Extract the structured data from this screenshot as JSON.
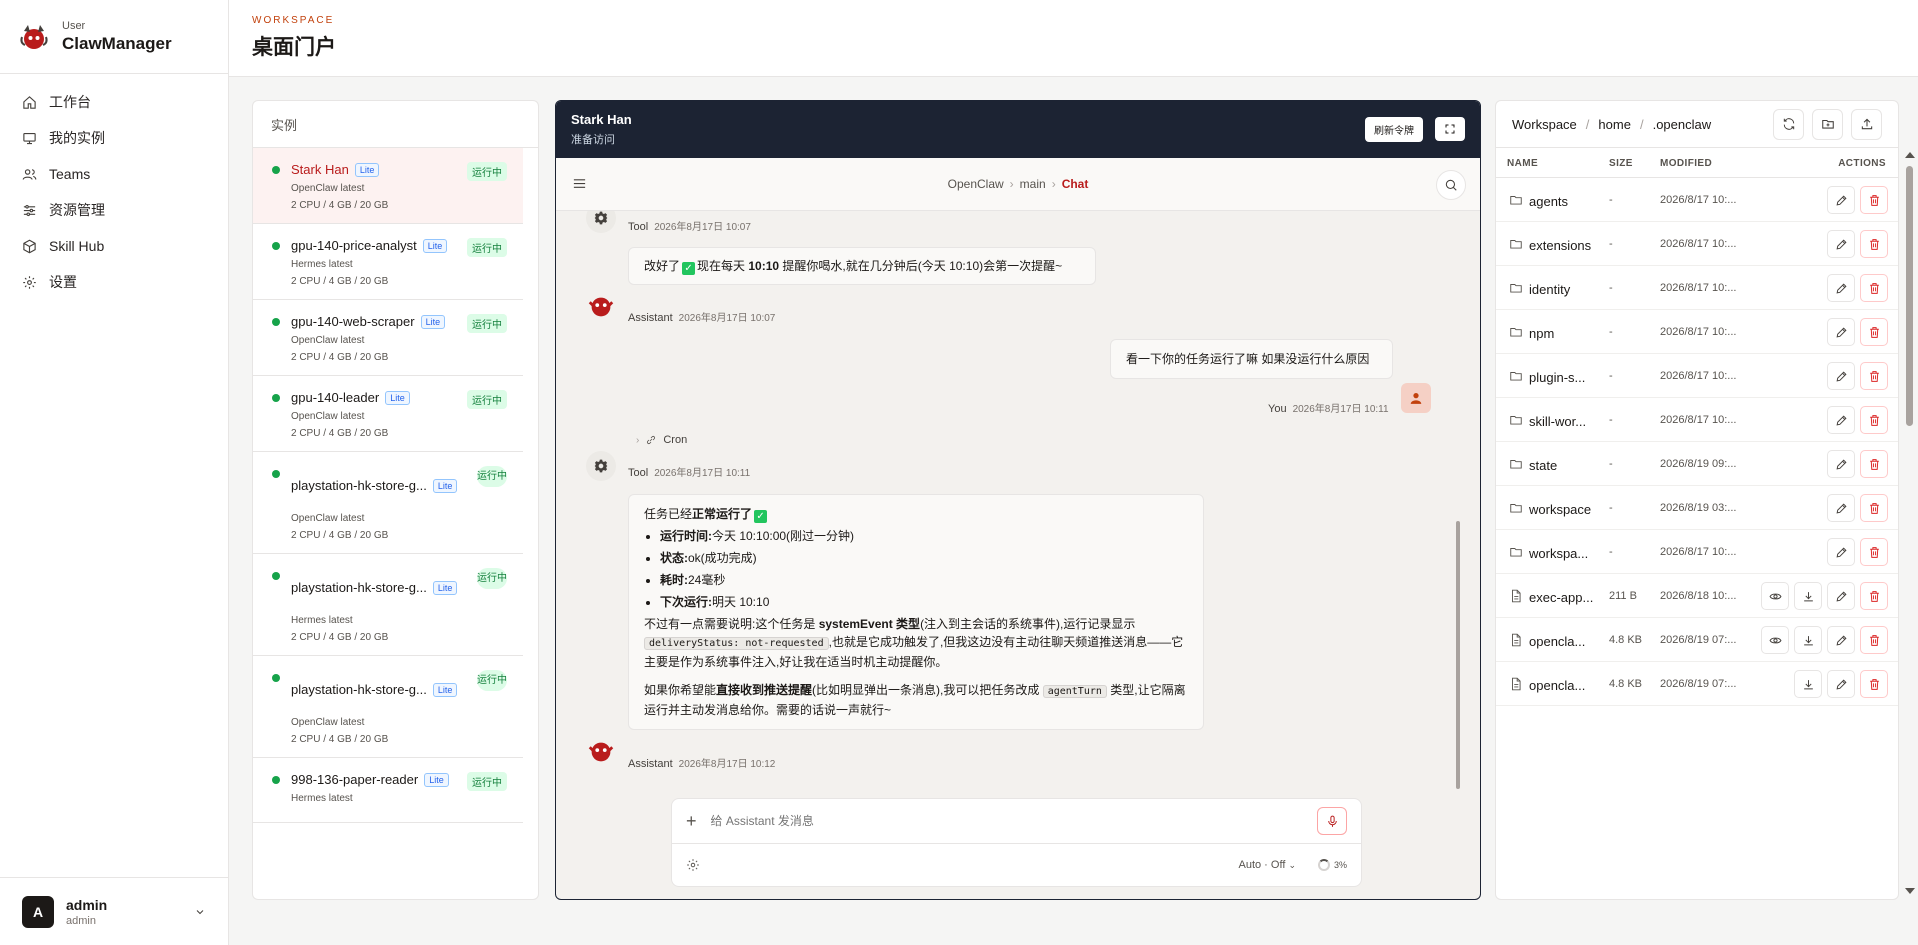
{
  "brand": {
    "sub": "User",
    "name": "ClawManager"
  },
  "nav": [
    {
      "label": "工作台",
      "icon": "home-icon"
    },
    {
      "label": "我的实例",
      "icon": "monitor-icon"
    },
    {
      "label": "Teams",
      "icon": "users-icon"
    },
    {
      "label": "资源管理",
      "icon": "sliders-icon"
    },
    {
      "label": "Skill Hub",
      "icon": "cube-icon"
    },
    {
      "label": "设置",
      "icon": "gear-icon"
    }
  ],
  "user": {
    "initial": "A",
    "name": "admin",
    "role": "admin"
  },
  "header": {
    "eyebrow": "WORKSPACE",
    "title": "桌面门户"
  },
  "instances": {
    "title": "实例",
    "lite_label": "Lite",
    "running_label": "运行中",
    "items": [
      {
        "name": "Stark Han",
        "type": "OpenClaw latest",
        "spec": "2 CPU / 4 GB / 20 GB"
      },
      {
        "name": "gpu-140-price-analyst",
        "type": "Hermes latest",
        "spec": "2 CPU / 4 GB / 20 GB"
      },
      {
        "name": "gpu-140-web-scraper",
        "type": "OpenClaw latest",
        "spec": "2 CPU / 4 GB / 20 GB"
      },
      {
        "name": "gpu-140-leader",
        "type": "OpenClaw latest",
        "spec": "2 CPU / 4 GB / 20 GB"
      },
      {
        "name": "playstation-hk-store-g...",
        "type": "OpenClaw latest",
        "spec": "2 CPU / 4 GB / 20 GB"
      },
      {
        "name": "playstation-hk-store-g...",
        "type": "Hermes latest",
        "spec": "2 CPU / 4 GB / 20 GB"
      },
      {
        "name": "playstation-hk-store-g...",
        "type": "OpenClaw latest",
        "spec": "2 CPU / 4 GB / 20 GB"
      },
      {
        "name": "998-136-paper-reader",
        "type": "Hermes latest",
        "spec": ""
      }
    ]
  },
  "chat": {
    "user": "Stark Han",
    "status": "准备访问",
    "refresh_label": "刷新令牌",
    "crumbs": [
      "OpenClaw",
      "main",
      "Chat"
    ],
    "tool_label": "Tool",
    "assistant_label": "Assistant",
    "you_label": "You",
    "t1": "2026年8月17日 10:07",
    "t2": "2026年8月17日 10:07",
    "t3": "2026年8月17日 10:11",
    "t4": "2026年8月17日 10:11",
    "t5": "2026年8月17日 10:12",
    "m1_a": "改好了",
    "m1_b": "现在每天",
    "m1_bold": "10:10",
    "m1_c": "提醒你喝水,就在几分钟后(今天 10:10)会第一次提醒~",
    "m2": "看一下你的任务运行了嘛 如果没运行什么原因",
    "cron": "Cron",
    "m3_intro": "任务已经",
    "m3_intro_bold": "正常运行了",
    "m3_items": [
      {
        "k": "运行时间:",
        "v": "今天 10:10:00(刚过一分钟)"
      },
      {
        "k": "状态:",
        "v": "ok(成功完成)"
      },
      {
        "k": "耗时:",
        "v": "24毫秒"
      },
      {
        "k": "下次运行:",
        "v": "明天 10:10"
      }
    ],
    "m3_p1_a": "不过有一点需要说明:这个任务是",
    "m3_p1_bold": "systemEvent 类型",
    "m3_p1_b": "(注入到主会话的系统事件),运行记录显示",
    "m3_p1_code": "deliveryStatus: not-requested",
    "m3_p1_c": ",也就是它成功触发了,但我这边没有主动往聊天频道推送消息——它主要是作为系统事件注入,好让我在适当时机主动提醒你。",
    "m3_p2_a": "如果你希望能",
    "m3_p2_bold": "直接收到推送提醒",
    "m3_p2_b": "(比如明显弹出一条消息),我可以把任务改成",
    "m3_p2_code": "agentTurn",
    "m3_p2_c": "类型,让它隔离运行并主动发消息给你。需要的话说一声就行~",
    "composer_placeholder": "给 Assistant 发消息",
    "mode": "Auto · Off",
    "context": "3%"
  },
  "files": {
    "crumbs": [
      "Workspace",
      "home",
      ".openclaw"
    ],
    "cols": {
      "name": "NAME",
      "size": "SIZE",
      "modified": "MODIFIED",
      "actions": "ACTIONS"
    },
    "rows": [
      {
        "name": "agents",
        "size": "-",
        "mod": "2026/8/17 10:...",
        "kind": "folder",
        "view": false,
        "download": false
      },
      {
        "name": "extensions",
        "size": "-",
        "mod": "2026/8/17 10:...",
        "kind": "folder",
        "view": false,
        "download": false
      },
      {
        "name": "identity",
        "size": "-",
        "mod": "2026/8/17 10:...",
        "kind": "folder",
        "view": false,
        "download": false
      },
      {
        "name": "npm",
        "size": "-",
        "mod": "2026/8/17 10:...",
        "kind": "folder",
        "view": false,
        "download": false
      },
      {
        "name": "plugin-s...",
        "size": "-",
        "mod": "2026/8/17 10:...",
        "kind": "folder",
        "view": false,
        "download": false
      },
      {
        "name": "skill-wor...",
        "size": "-",
        "mod": "2026/8/17 10:...",
        "kind": "folder",
        "view": false,
        "download": false
      },
      {
        "name": "state",
        "size": "-",
        "mod": "2026/8/19 09:...",
        "kind": "folder",
        "view": false,
        "download": false
      },
      {
        "name": "workspace",
        "size": "-",
        "mod": "2026/8/19 03:...",
        "kind": "folder",
        "view": false,
        "download": false
      },
      {
        "name": "workspa...",
        "size": "-",
        "mod": "2026/8/17 10:...",
        "kind": "folder",
        "view": false,
        "download": false
      },
      {
        "name": "exec-app...",
        "size": "211 B",
        "mod": "2026/8/18 10:...",
        "kind": "file",
        "view": true,
        "download": true
      },
      {
        "name": "opencla...",
        "size": "4.8 KB",
        "mod": "2026/8/19 07:...",
        "kind": "file",
        "view": true,
        "download": true
      },
      {
        "name": "opencla...",
        "size": "4.8 KB",
        "mod": "2026/8/19 07:...",
        "kind": "file",
        "view": false,
        "download": true
      }
    ]
  },
  "colors": {
    "accent": "#b91c1c",
    "dark": "#1c2333",
    "running": "#16a34a"
  }
}
